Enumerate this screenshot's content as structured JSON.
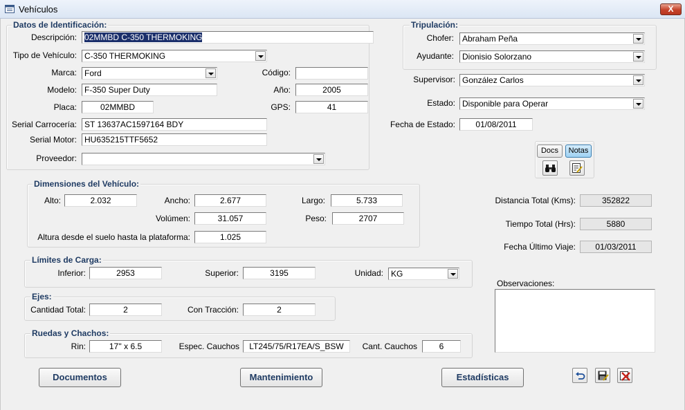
{
  "window": {
    "title": "Vehículos",
    "close_label": "X"
  },
  "identificacion": {
    "title": "Datos de Identificación:",
    "descripcion_label": "Descripción:",
    "descripcion": "02MMBD C-350 THERMOKING",
    "tipo_label": "Tipo de Vehículo:",
    "tipo": "C-350 THERMOKING",
    "marca_label": "Marca:",
    "marca": "Ford",
    "codigo_label": "Código:",
    "codigo": "",
    "modelo_label": "Modelo:",
    "modelo": "F-350 Super Duty",
    "anio_label": "Año:",
    "anio": "2005",
    "placa_label": "Placa:",
    "placa": "02MMBD",
    "gps_label": "GPS:",
    "gps": "41",
    "serial_carroceria_label": "Serial Carrocería:",
    "serial_carroceria": "ST 13637AC1597164 BDY",
    "serial_motor_label": "Serial Motor:",
    "serial_motor": "HU635215TTF5652",
    "proveedor_label": "Proveedor:",
    "proveedor": ""
  },
  "tripulacion": {
    "title": "Tripulación:",
    "chofer_label": "Chofer:",
    "chofer": "Abraham Peña",
    "ayudante_label": "Ayudante:",
    "ayudante": "Dionisio Solorzano"
  },
  "supervisor_label": "Supervisor:",
  "supervisor": "González Carlos",
  "estado_label": "Estado:",
  "estado": "Disponible para Operar",
  "fecha_estado_label": "Fecha de Estado:",
  "fecha_estado": "01/08/2011",
  "docs_label": "Docs",
  "notas_label": "Notas",
  "dimensiones": {
    "title": "Dimensiones del Vehículo:",
    "alto_label": "Alto:",
    "alto": "2.032",
    "ancho_label": "Ancho:",
    "ancho": "2.677",
    "largo_label": "Largo:",
    "largo": "5.733",
    "volumen_label": "Volúmen:",
    "volumen": "31.057",
    "peso_label": "Peso:",
    "peso": "2707",
    "altura_label": "Altura desde el suelo hasta la plataforma:",
    "altura": "1.025"
  },
  "estadisticas": {
    "distancia_label": "Distancia Total (Kms):",
    "distancia": "352822",
    "tiempo_label": "Tiempo Total (Hrs):",
    "tiempo": "5880",
    "fecha_label": "Fecha Último Viaje:",
    "fecha": "01/03/2011"
  },
  "limites": {
    "title": "Límites de Carga:",
    "inferior_label": "Inferior:",
    "inferior": "2953",
    "superior_label": "Superior:",
    "superior": "3195",
    "unidad_label": "Unidad:",
    "unidad": "KG"
  },
  "ejes": {
    "title": "Ejes:",
    "cantidad_label": "Cantidad Total:",
    "cantidad": "2",
    "traccion_label": "Con Tracción:",
    "traccion": "2"
  },
  "ruedas": {
    "title": "Ruedas y Chachos:",
    "rin_label": "Rin:",
    "rin": "17'' x 6.5",
    "espec_label": "Espec. Cauchos",
    "espec": "LT245/75/R17EA/S_BSW",
    "cant_label": "Cant. Cauchos",
    "cant": "6"
  },
  "observaciones_label": "Observaciones:",
  "buttons": {
    "documentos": "Documentos",
    "mantenimiento": "Mantenimiento",
    "estadisticas": "Estadísticas"
  },
  "icons": {
    "window": "form-icon",
    "search": "binoculars-icon",
    "edit": "edit-note-icon",
    "undo": "undo-icon",
    "save": "save-icon",
    "delete": "delete-icon"
  }
}
